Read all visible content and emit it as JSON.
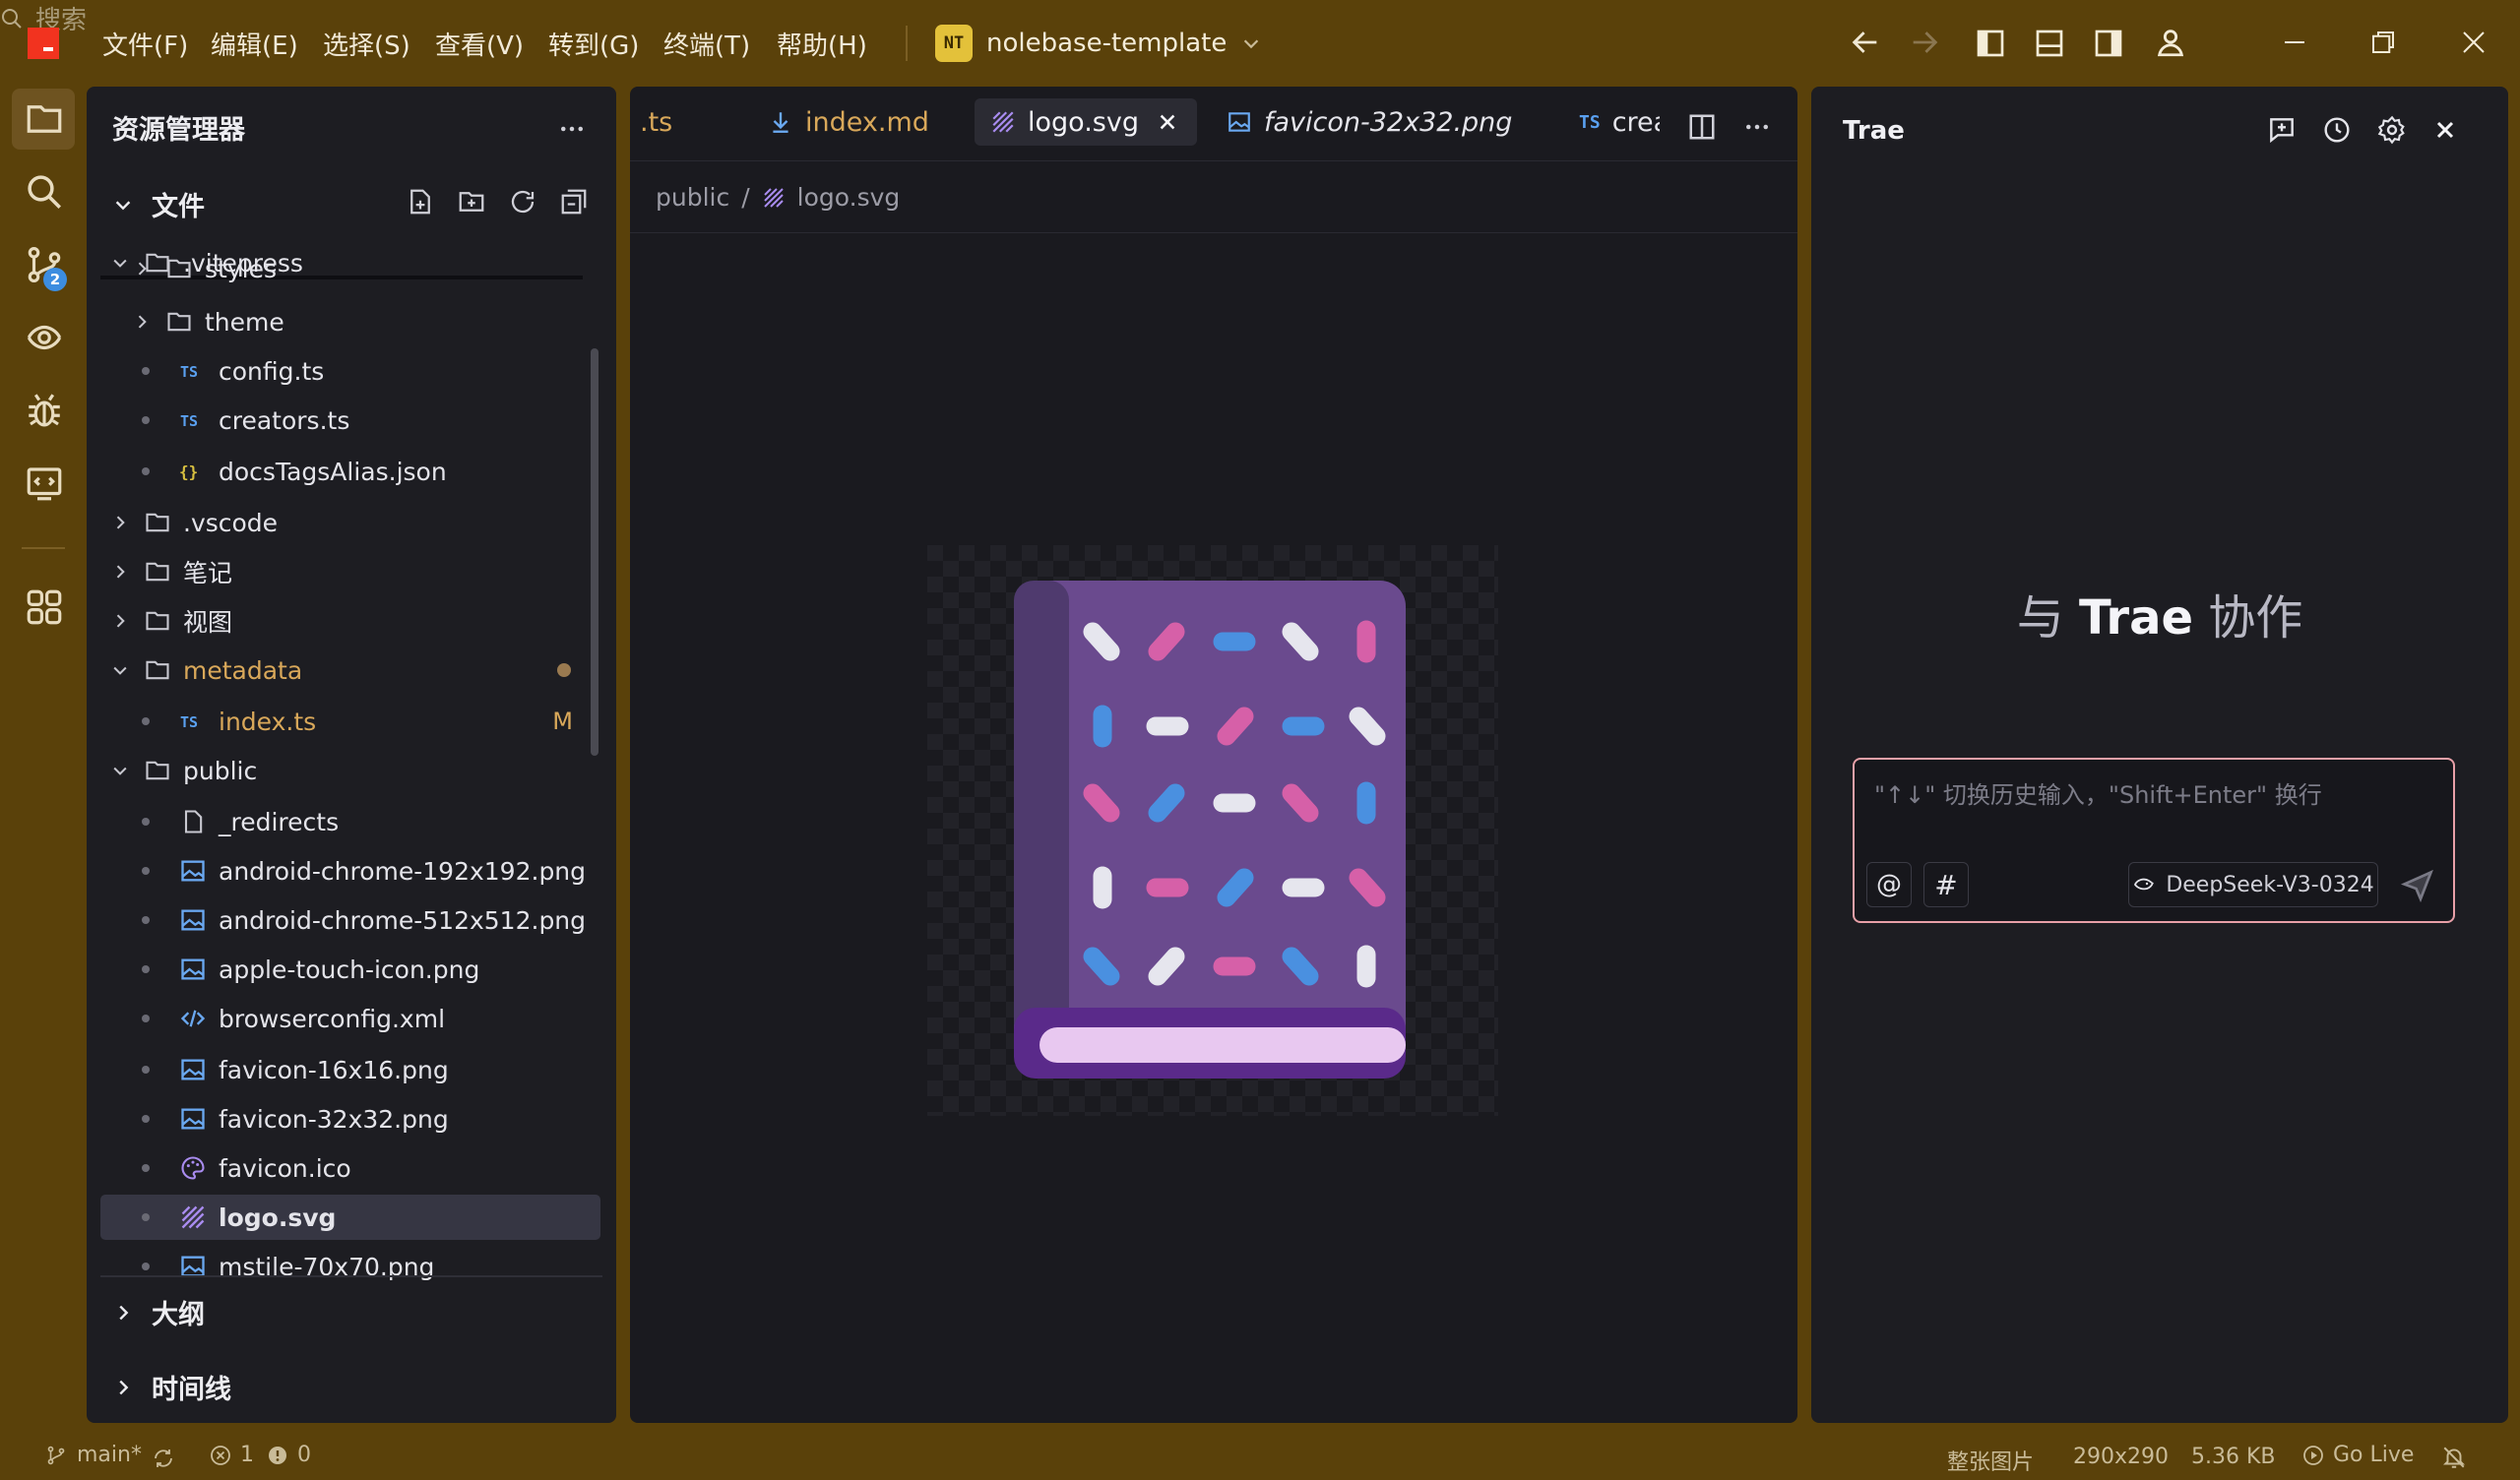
{
  "menu": [
    "文件(F)",
    "编辑(E)",
    "选择(S)",
    "查看(V)",
    "转到(G)",
    "终端(T)",
    "帮助(H)"
  ],
  "project": {
    "badge": "NT",
    "name": "nolebase-template"
  },
  "search": {
    "placeholder": "搜索"
  },
  "scm_badge": "2",
  "explorer": {
    "title": "资源管理器",
    "files_section": "文件",
    "outline_section": "大纲",
    "timeline_section": "时间线",
    "tree": [
      {
        "label": ".vitepress",
        "kind": "folder",
        "open": true,
        "depth": 0
      },
      {
        "label": "styles",
        "kind": "folder",
        "open": false,
        "depth": 1
      },
      {
        "label": "theme",
        "kind": "folder",
        "open": false,
        "depth": 1
      },
      {
        "label": "config.ts",
        "kind": "ts",
        "depth": 1
      },
      {
        "label": "creators.ts",
        "kind": "ts",
        "depth": 1
      },
      {
        "label": "docsTagsAlias.json",
        "kind": "json",
        "depth": 1
      },
      {
        "label": ".vscode",
        "kind": "folder",
        "open": false,
        "depth": 0
      },
      {
        "label": "笔记",
        "kind": "folder",
        "open": false,
        "depth": 0
      },
      {
        "label": "视图",
        "kind": "folder",
        "open": false,
        "depth": 0
      },
      {
        "label": "metadata",
        "kind": "folder",
        "open": true,
        "depth": 0,
        "modified_dot": true
      },
      {
        "label": "index.ts",
        "kind": "ts",
        "depth": 1,
        "badge": "M"
      },
      {
        "label": "public",
        "kind": "folder",
        "open": true,
        "depth": 0
      },
      {
        "label": "_redirects",
        "kind": "file",
        "depth": 1
      },
      {
        "label": "android-chrome-192x192.png",
        "kind": "image",
        "depth": 1
      },
      {
        "label": "android-chrome-512x512.png",
        "kind": "image",
        "depth": 1
      },
      {
        "label": "apple-touch-icon.png",
        "kind": "image",
        "depth": 1
      },
      {
        "label": "browserconfig.xml",
        "kind": "xml",
        "depth": 1
      },
      {
        "label": "favicon-16x16.png",
        "kind": "image",
        "depth": 1
      },
      {
        "label": "favicon-32x32.png",
        "kind": "image",
        "depth": 1
      },
      {
        "label": "favicon.ico",
        "kind": "ico",
        "depth": 1
      },
      {
        "label": "logo.svg",
        "kind": "svg",
        "depth": 1,
        "selected": true
      },
      {
        "label": "mstile-70x70.png",
        "kind": "image",
        "depth": 1
      }
    ]
  },
  "tabs": [
    {
      "label": ".ts",
      "style": "partial"
    },
    {
      "label": "index.md",
      "style": "modified"
    },
    {
      "label": "logo.svg",
      "style": "active"
    },
    {
      "label": "favicon-32x32.png",
      "style": "preview"
    },
    {
      "label": "creat",
      "icon_text": "TS",
      "style": "partial"
    }
  ],
  "breadcrumb": {
    "folder": "public",
    "sep": "/",
    "file": "logo.svg"
  },
  "trae": {
    "title": "Trae",
    "collab_prefix": "与 ",
    "collab_brand": "Trae",
    "collab_suffix": " 协作",
    "input_placeholder": "\"↑↓\" 切换历史输入，\"Shift+Enter\" 换行",
    "mention_btn": "@",
    "hash_btn": "#",
    "model": "DeepSeek-V3-0324"
  },
  "status": {
    "branch": "main*",
    "errors": "1",
    "warnings": "0",
    "view_mode": "整张图片",
    "dimensions": "290x290",
    "size": "5.36 KB",
    "go_live": "Go Live"
  },
  "colors": {
    "accent_titlebar": "#5a410a",
    "selected_row": "#363643",
    "panel_bg": "#1d1d22",
    "chat_border": "#e8a0a8"
  }
}
